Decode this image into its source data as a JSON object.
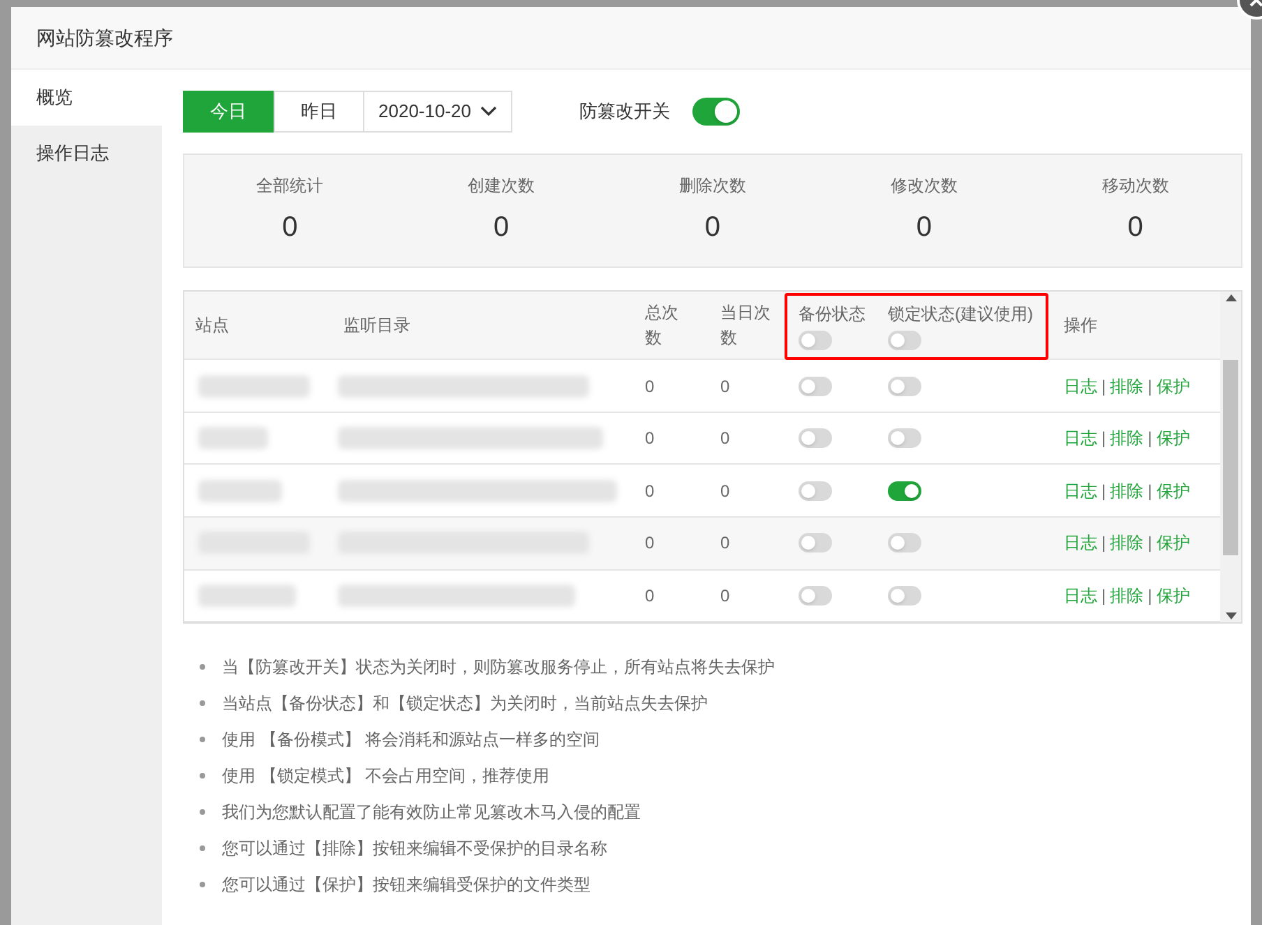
{
  "window": {
    "title": "网站防篡改程序"
  },
  "sidebar": {
    "items": [
      {
        "label": "概览",
        "selected": true
      },
      {
        "label": "操作日志",
        "selected": false
      }
    ]
  },
  "day_tabs": [
    {
      "label": "今日",
      "selected": true
    },
    {
      "label": "昨日",
      "selected": false
    }
  ],
  "date_select": {
    "value": "2020-10-20"
  },
  "master_switch": {
    "label": "防篡改开关",
    "on": true
  },
  "stats": [
    {
      "label": "全部统计",
      "value": "0"
    },
    {
      "label": "创建次数",
      "value": "0"
    },
    {
      "label": "删除次数",
      "value": "0"
    },
    {
      "label": "修改次数",
      "value": "0"
    },
    {
      "label": "移动次数",
      "value": "0"
    }
  ],
  "table": {
    "columns": [
      "站点",
      "监听目录",
      "总次数",
      "当日次数",
      "备份状态",
      "锁定状态(建议使用)",
      "操作"
    ],
    "header_switches": [
      {
        "on": false
      },
      {
        "on": false
      }
    ],
    "action_separator": "|",
    "rows": [
      {
        "total": "0",
        "today": "0",
        "backup": false,
        "lock": false,
        "actions": [
          "日志",
          "排除",
          "保护"
        ]
      },
      {
        "total": "0",
        "today": "0",
        "backup": false,
        "lock": false,
        "actions": [
          "日志",
          "排除",
          "保护"
        ]
      },
      {
        "total": "0",
        "today": "0",
        "backup": false,
        "lock": true,
        "actions": [
          "日志",
          "排除",
          "保护"
        ]
      },
      {
        "total": "0",
        "today": "0",
        "backup": false,
        "lock": false,
        "actions": [
          "日志",
          "排除",
          "保护"
        ]
      },
      {
        "total": "0",
        "today": "0",
        "backup": false,
        "lock": false,
        "actions": [
          "日志",
          "排除",
          "保护"
        ]
      }
    ]
  },
  "notes": [
    "当【防篡改开关】状态为关闭时，则防篡改服务停止，所有站点将失去保护",
    "当站点【备份状态】和【锁定状态】为关闭时，当前站点失去保护",
    "使用 【备份模式】 将会消耗和源站点一样多的空间",
    "使用 【锁定模式】 不会占用空间，推荐使用",
    "我们为您默认配置了能有效防止常见篡改木马入侵的配置",
    "您可以通过【排除】按钮来编辑不受保护的目录名称",
    "您可以通过【保护】按钮来编辑受保护的文件类型"
  ]
}
